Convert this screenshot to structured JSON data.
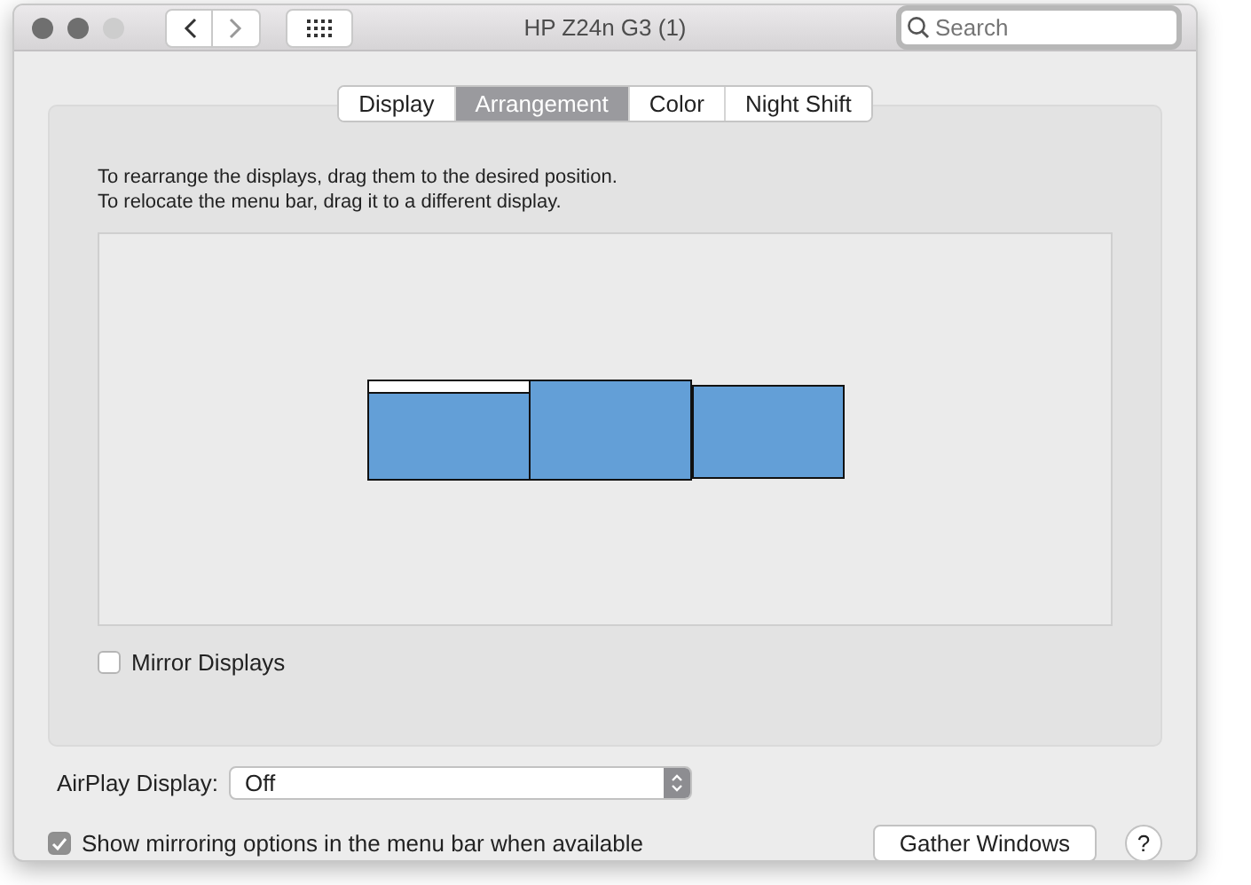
{
  "window": {
    "title": "HP Z24n G3 (1)"
  },
  "search": {
    "placeholder": "Search"
  },
  "tabs": [
    {
      "label": "Display",
      "selected": false
    },
    {
      "label": "Arrangement",
      "selected": true
    },
    {
      "label": "Color",
      "selected": false
    },
    {
      "label": "Night Shift",
      "selected": false
    }
  ],
  "instructions": [
    "To rearrange the displays, drag them to the desired position.",
    "To relocate the menu bar, drag it to a different display."
  ],
  "displays": [
    {
      "has_menu_bar": true
    },
    {
      "has_menu_bar": false
    },
    {
      "has_menu_bar": false
    }
  ],
  "mirror_displays": {
    "label": "Mirror Displays",
    "checked": false
  },
  "airplay": {
    "label": "AirPlay Display:",
    "value": "Off"
  },
  "show_mirroring": {
    "label": "Show mirroring options in the menu bar when available",
    "checked": true
  },
  "buttons": [
    "Gather Windows"
  ],
  "help": "?"
}
